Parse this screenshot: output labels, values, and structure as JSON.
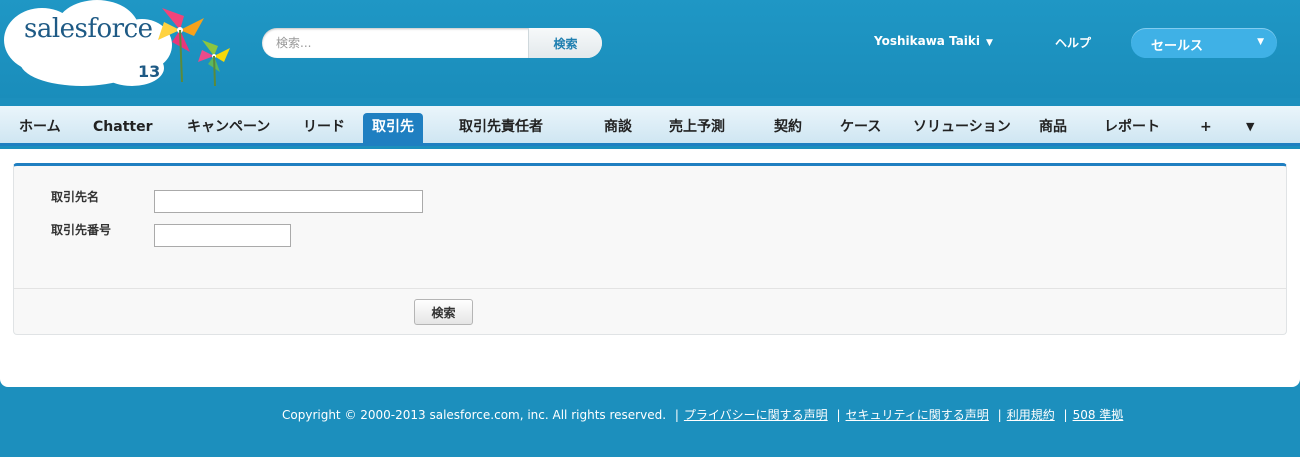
{
  "header": {
    "logo_text": "salesforce",
    "logo_version": "13",
    "search": {
      "placeholder": "検索...",
      "button_label": "検索"
    },
    "user_name": "Yoshikawa Taiki",
    "help_label": "ヘルプ",
    "app_name": "セールス"
  },
  "tabs": [
    {
      "label": "ホーム",
      "active": false
    },
    {
      "label": "Chatter",
      "active": false
    },
    {
      "label": "キャンペーン",
      "active": false
    },
    {
      "label": "リード",
      "active": false
    },
    {
      "label": "取引先",
      "active": true
    },
    {
      "label": "取引先責任者",
      "active": false
    },
    {
      "label": "商談",
      "active": false
    },
    {
      "label": "売上予測",
      "active": false
    },
    {
      "label": "契約",
      "active": false
    },
    {
      "label": "ケース",
      "active": false
    },
    {
      "label": "ソリューション",
      "active": false
    },
    {
      "label": "商品",
      "active": false
    },
    {
      "label": "レポート",
      "active": false
    },
    {
      "label": "+",
      "active": false
    },
    {
      "label": "▼",
      "active": false
    }
  ],
  "form": {
    "account_name_label": "取引先名",
    "account_name_value": "",
    "account_number_label": "取引先番号",
    "account_number_value": "",
    "submit_label": "検索"
  },
  "footer": {
    "copyright": "Copyright © 2000-2013 salesforce.com, inc. All rights reserved.",
    "links": [
      "プライバシーに関する声明",
      "セキュリティに関する声明",
      "利用規約",
      "508 準拠"
    ]
  },
  "colors": {
    "header_bg": "#1c8fbd",
    "tab_active": "#1f7fc1",
    "app_picker": "#3fb1e6"
  }
}
